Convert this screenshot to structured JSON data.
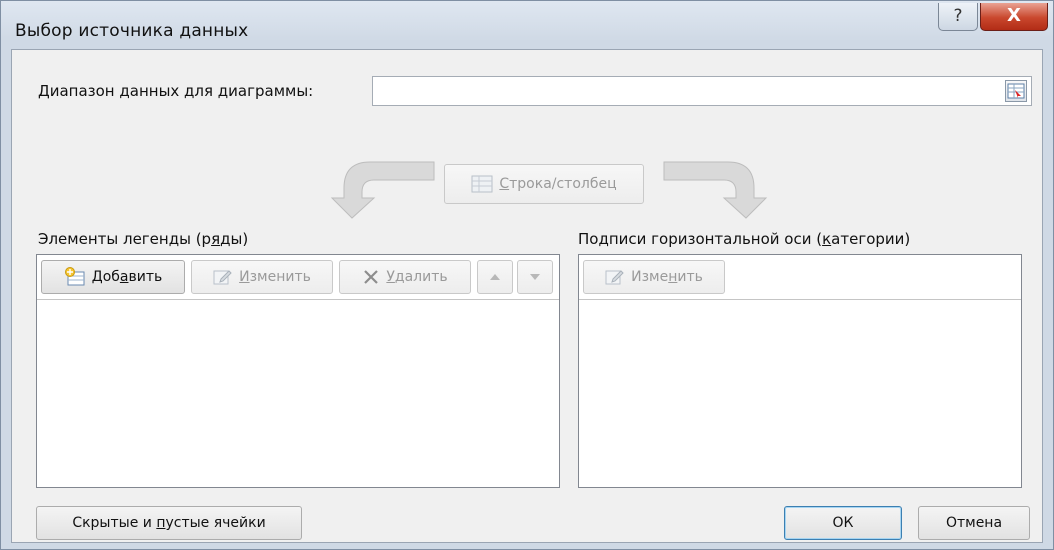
{
  "window": {
    "title": "Выбор источника данных",
    "help_glyph": "?",
    "close_glyph": "X"
  },
  "range": {
    "label_prefix": "Д",
    "label_rest": "иапазон данных для диаграммы:",
    "value": ""
  },
  "switch_button": {
    "label_u": "С",
    "label_rest": "трока/столбец"
  },
  "legend": {
    "title_prefix": "Элементы легенды (р",
    "title_u": "я",
    "title_suffix": "ды)",
    "add": {
      "pre": "Доб",
      "u": "а",
      "post": "вить"
    },
    "edit": {
      "pre": "",
      "u": "И",
      "post": "зменить"
    },
    "delete": {
      "pre": "",
      "u": "У",
      "post": "далить"
    },
    "items": []
  },
  "axis": {
    "title_prefix": "Подписи горизонтальной оси (",
    "title_u": "к",
    "title_suffix": "атегории)",
    "edit": {
      "pre": "Изме",
      "u": "н",
      "post": "ить"
    },
    "items": []
  },
  "footer": {
    "hidden_cells": {
      "pre": "Скрытые и ",
      "u": "п",
      "post": "устые ячейки"
    },
    "ok": "ОК",
    "cancel": "Отмена"
  },
  "icons": {
    "help": "help-icon",
    "close": "close-icon",
    "range_select": "range-select-icon",
    "switch": "switch-row-column-icon",
    "add": "add-series-icon",
    "edit": "edit-icon",
    "delete": "delete-x-icon",
    "up": "move-up-icon",
    "down": "move-down-icon"
  }
}
